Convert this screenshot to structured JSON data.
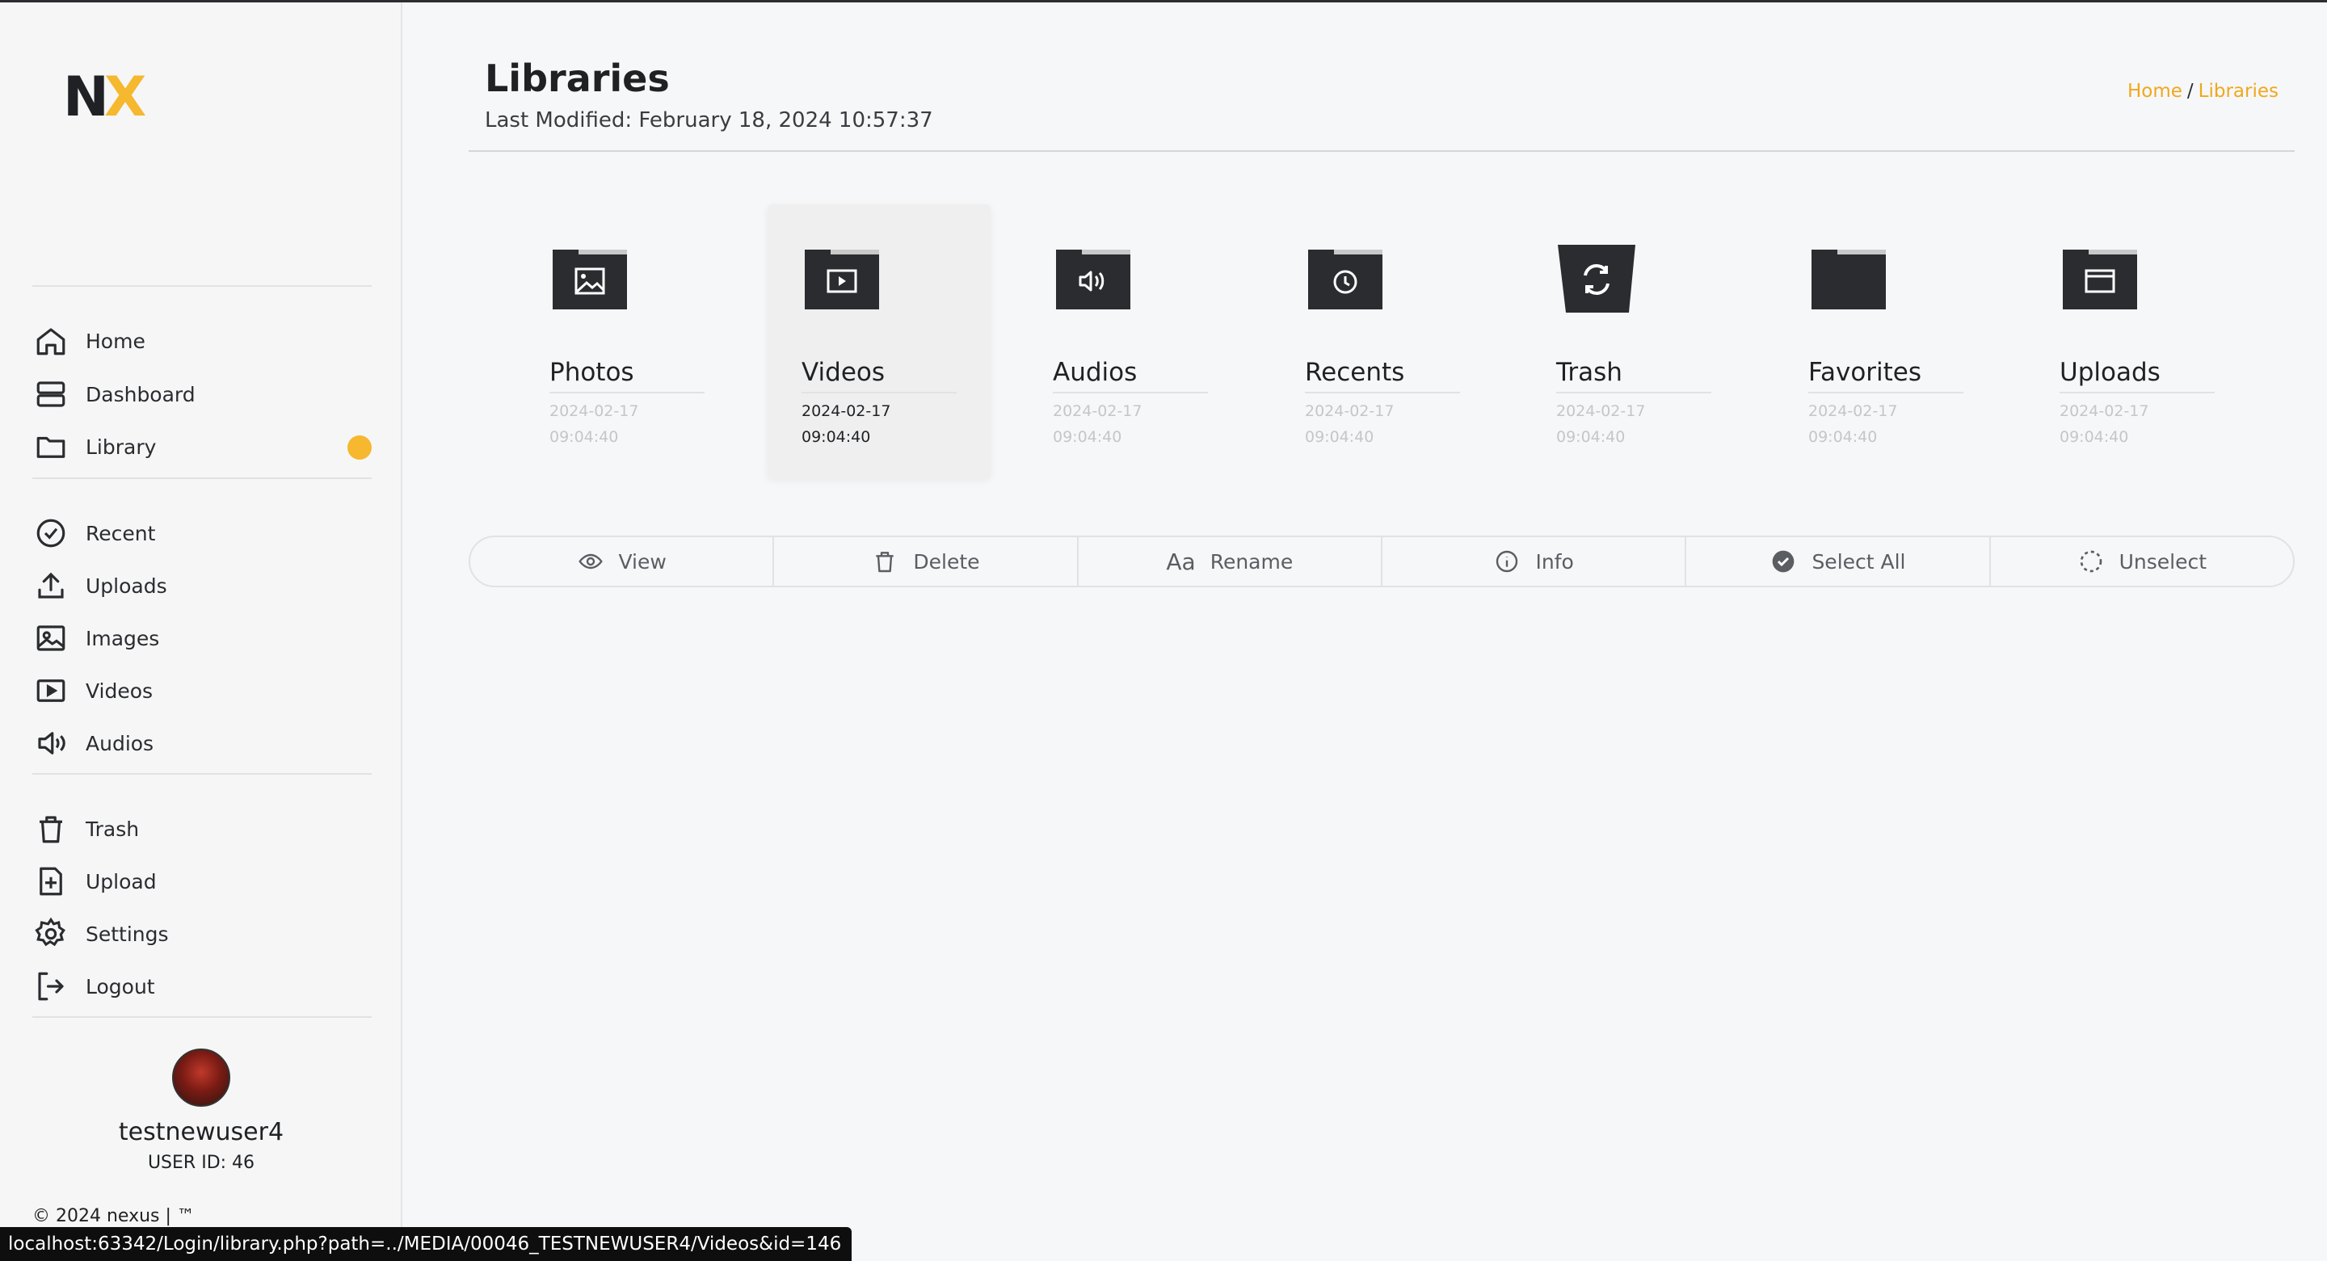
{
  "logo": {
    "n": "N",
    "x": "X"
  },
  "nav": {
    "group1": [
      {
        "label": "Home",
        "icon": "home-icon"
      },
      {
        "label": "Dashboard",
        "icon": "dashboard-icon"
      },
      {
        "label": "Library",
        "icon": "folder-icon"
      }
    ],
    "group2": [
      {
        "label": "Recent",
        "icon": "check-circle-icon"
      },
      {
        "label": "Uploads",
        "icon": "upload-icon"
      },
      {
        "label": "Images",
        "icon": "image-icon"
      },
      {
        "label": "Videos",
        "icon": "video-icon"
      },
      {
        "label": "Audios",
        "icon": "speaker-icon"
      }
    ],
    "group3": [
      {
        "label": "Trash",
        "icon": "trash-icon"
      },
      {
        "label": "Upload",
        "icon": "file-plus-icon"
      },
      {
        "label": "Settings",
        "icon": "gear-icon"
      },
      {
        "label": "Logout",
        "icon": "logout-icon"
      }
    ]
  },
  "profile": {
    "username": "testnewuser4",
    "user_id": "USER ID: 46"
  },
  "copyright": "© 2024 nexus | ™",
  "statusbar": "localhost:63342/Login/library.php?path=../MEDIA/00046_TESTNEWUSER4/Videos&id=146",
  "header": {
    "title": "Libraries",
    "modified": "Last Modified: February 18, 2024 10:57:37",
    "breadcrumb_home": "Home",
    "breadcrumb_sep": "/",
    "breadcrumb_current": "Libraries"
  },
  "libraries": [
    {
      "name": "Photos",
      "date": "2024-02-17",
      "time": "09:04:40",
      "icon": "photos-folder-icon"
    },
    {
      "name": "Videos",
      "date": "2024-02-17",
      "time": "09:04:40",
      "icon": "videos-folder-icon"
    },
    {
      "name": "Audios",
      "date": "2024-02-17",
      "time": "09:04:40",
      "icon": "audios-folder-icon"
    },
    {
      "name": "Recents",
      "date": "2024-02-17",
      "time": "09:04:40",
      "icon": "recents-folder-icon"
    },
    {
      "name": "Trash",
      "date": "2024-02-17",
      "time": "09:04:40",
      "icon": "trash-bin-icon"
    },
    {
      "name": "Favorites",
      "date": "2024-02-17",
      "time": "09:04:40",
      "icon": "favorites-folder-icon"
    },
    {
      "name": "Uploads",
      "date": "2024-02-17",
      "time": "09:04:40",
      "icon": "uploads-folder-icon"
    }
  ],
  "toolbar": {
    "view": "View",
    "delete": "Delete",
    "rename_icon_text": "Aa",
    "rename": "Rename",
    "info": "Info",
    "select_all": "Select All",
    "unselect": "Unselect"
  },
  "colors": {
    "accent": "#f5b82e",
    "link": "#f0a81c",
    "folder": "#2a2c30"
  }
}
